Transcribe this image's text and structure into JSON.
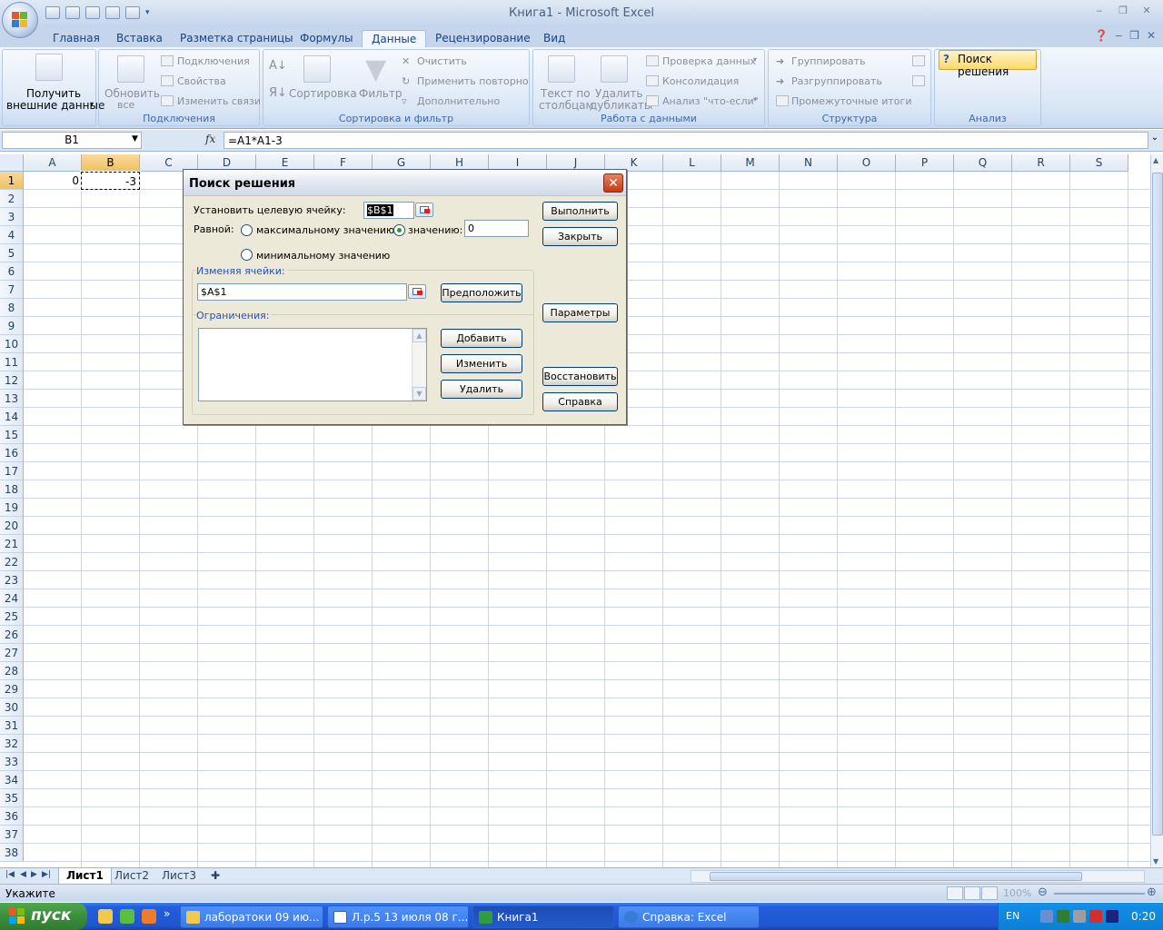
{
  "window": {
    "title": "Книга1 - Microsoft Excel"
  },
  "ribbon_tabs": [
    "Главная",
    "Вставка",
    "Разметка страницы",
    "Формулы",
    "Данные",
    "Рецензирование",
    "Вид"
  ],
  "active_tab": "Данные",
  "ribbon": {
    "external_data": {
      "label1": "Получить",
      "label2": "внешние данные"
    },
    "connections": {
      "refresh1": "Обновить",
      "refresh2": "все",
      "items": [
        "Подключения",
        "Свойства",
        "Изменить связи"
      ],
      "group_label": "Подключения"
    },
    "sort_filter": {
      "sort": "Сортировка",
      "filter": "Фильтр",
      "items": [
        "Очистить",
        "Применить повторно",
        "Дополнительно"
      ],
      "group_label": "Сортировка и фильтр"
    },
    "data_tools": {
      "text_cols1": "Текст по",
      "text_cols2": "столбцам",
      "remove_dup1": "Удалить",
      "remove_dup2": "дубликаты",
      "items": [
        "Проверка данных",
        "Консолидация",
        "Анализ \"что-если\""
      ],
      "group_label": "Работа с данными"
    },
    "outline": {
      "items": [
        "Группировать",
        "Разгруппировать",
        "Промежуточные итоги"
      ],
      "group_label": "Структура"
    },
    "analysis": {
      "solver": "Поиск решения",
      "group_label": "Анализ"
    }
  },
  "formula_bar": {
    "name_box": "B1",
    "fx": "fx",
    "formula": "=A1*A1-3"
  },
  "grid": {
    "columns": [
      "A",
      "B",
      "C",
      "D",
      "E",
      "F",
      "G",
      "H",
      "I",
      "J",
      "K",
      "L",
      "M",
      "N",
      "O",
      "P",
      "Q",
      "R",
      "S"
    ],
    "selected_column": "B",
    "selected_row": 1,
    "row_count": 38,
    "cells": {
      "A1": "0",
      "B1": "-3"
    }
  },
  "sheet_tabs": [
    "Лист1",
    "Лист2",
    "Лист3"
  ],
  "active_sheet": "Лист1",
  "status": {
    "mode": "Укажите",
    "zoom": "100%"
  },
  "dialog": {
    "title": "Поиск решения",
    "close": "✕",
    "target_label": "Установить целевую ячейку:",
    "target_value": "$B$1",
    "equal_label": "Равной:",
    "radio_max": "максимальному значению",
    "radio_value": "значению:",
    "value_input": "0",
    "radio_min": "минимальному значению",
    "selected_option": "value",
    "changing_label": "Изменяя ячейки:",
    "changing_value": "$A$1",
    "guess_button": "Предположить",
    "constraints_label": "Ограничения:",
    "add_button": "Добавить",
    "change_button": "Изменить",
    "delete_button": "Удалить",
    "solve_button": "Выполнить",
    "close_button": "Закрыть",
    "options_button": "Параметры",
    "reset_button": "Восстановить",
    "help_button": "Справка"
  },
  "taskbar": {
    "start": "пуск",
    "tasks": [
      "лаборатоки 09 ию...",
      "Л.р.5 13 июля 08 г....",
      "Книга1",
      "Справка: Excel"
    ],
    "active_task": "Книга1",
    "language": "EN",
    "time": "0:20"
  },
  "colors": {
    "ribbon_bg": "#d6e4f5",
    "accent": "#15428b",
    "selected_header": "#f1c15f",
    "taskbar": "#245edb",
    "start_green": "#3c8e3c"
  }
}
